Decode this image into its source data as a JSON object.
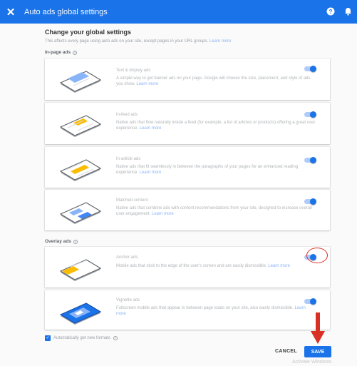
{
  "dialog": {
    "title": "Auto ads global settings",
    "close_icon": "close-icon",
    "help_icon": "help-icon",
    "notification_icon": "bell-icon",
    "accent_color": "#1a73e8"
  },
  "settings": {
    "heading": "Change your global settings",
    "subheading": "This affects every page using auto ads on your site, except pages in your URL groups.",
    "subheading_link": "Learn more"
  },
  "in_page": {
    "label": "In-page ads",
    "cards": [
      {
        "title": "Text & display ads",
        "desc": "A simple way to get banner ads on your page. Google will choose the size, placement, and style of ads you show.",
        "link": "Learn more",
        "enabled": true
      },
      {
        "title": "In-feed ads",
        "desc": "Native ads that flow naturally inside a feed (for example, a list of articles or products) offering a great user experience.",
        "link": "Learn more",
        "enabled": true
      },
      {
        "title": "In-article ads",
        "desc": "Native ads that fit seamlessly in between the paragraphs of your pages for an enhanced reading experience.",
        "link": "Learn more",
        "enabled": true
      },
      {
        "title": "Matched content",
        "desc": "Native ads that combine ads with content recommendations from your site, designed to increase overall user engagement.",
        "link": "Learn more",
        "enabled": true
      }
    ]
  },
  "overlay": {
    "label": "Overlay ads",
    "cards": [
      {
        "title": "Anchor ads",
        "desc": "Mobile ads that stick to the edge of the user's screen and are easily dismissible.",
        "link": "Learn more",
        "enabled": true
      },
      {
        "title": "Vignette ads",
        "desc": "Fullscreen mobile ads that appear in between page loads on your site, also easily dismissible.",
        "link": "Learn more",
        "enabled": true
      }
    ]
  },
  "footer": {
    "auto_formats_label": "Automatically get new formats",
    "auto_formats_checked": true,
    "cancel_label": "CANCEL",
    "save_label": "SAVE",
    "watermark": "Activate Windows"
  }
}
